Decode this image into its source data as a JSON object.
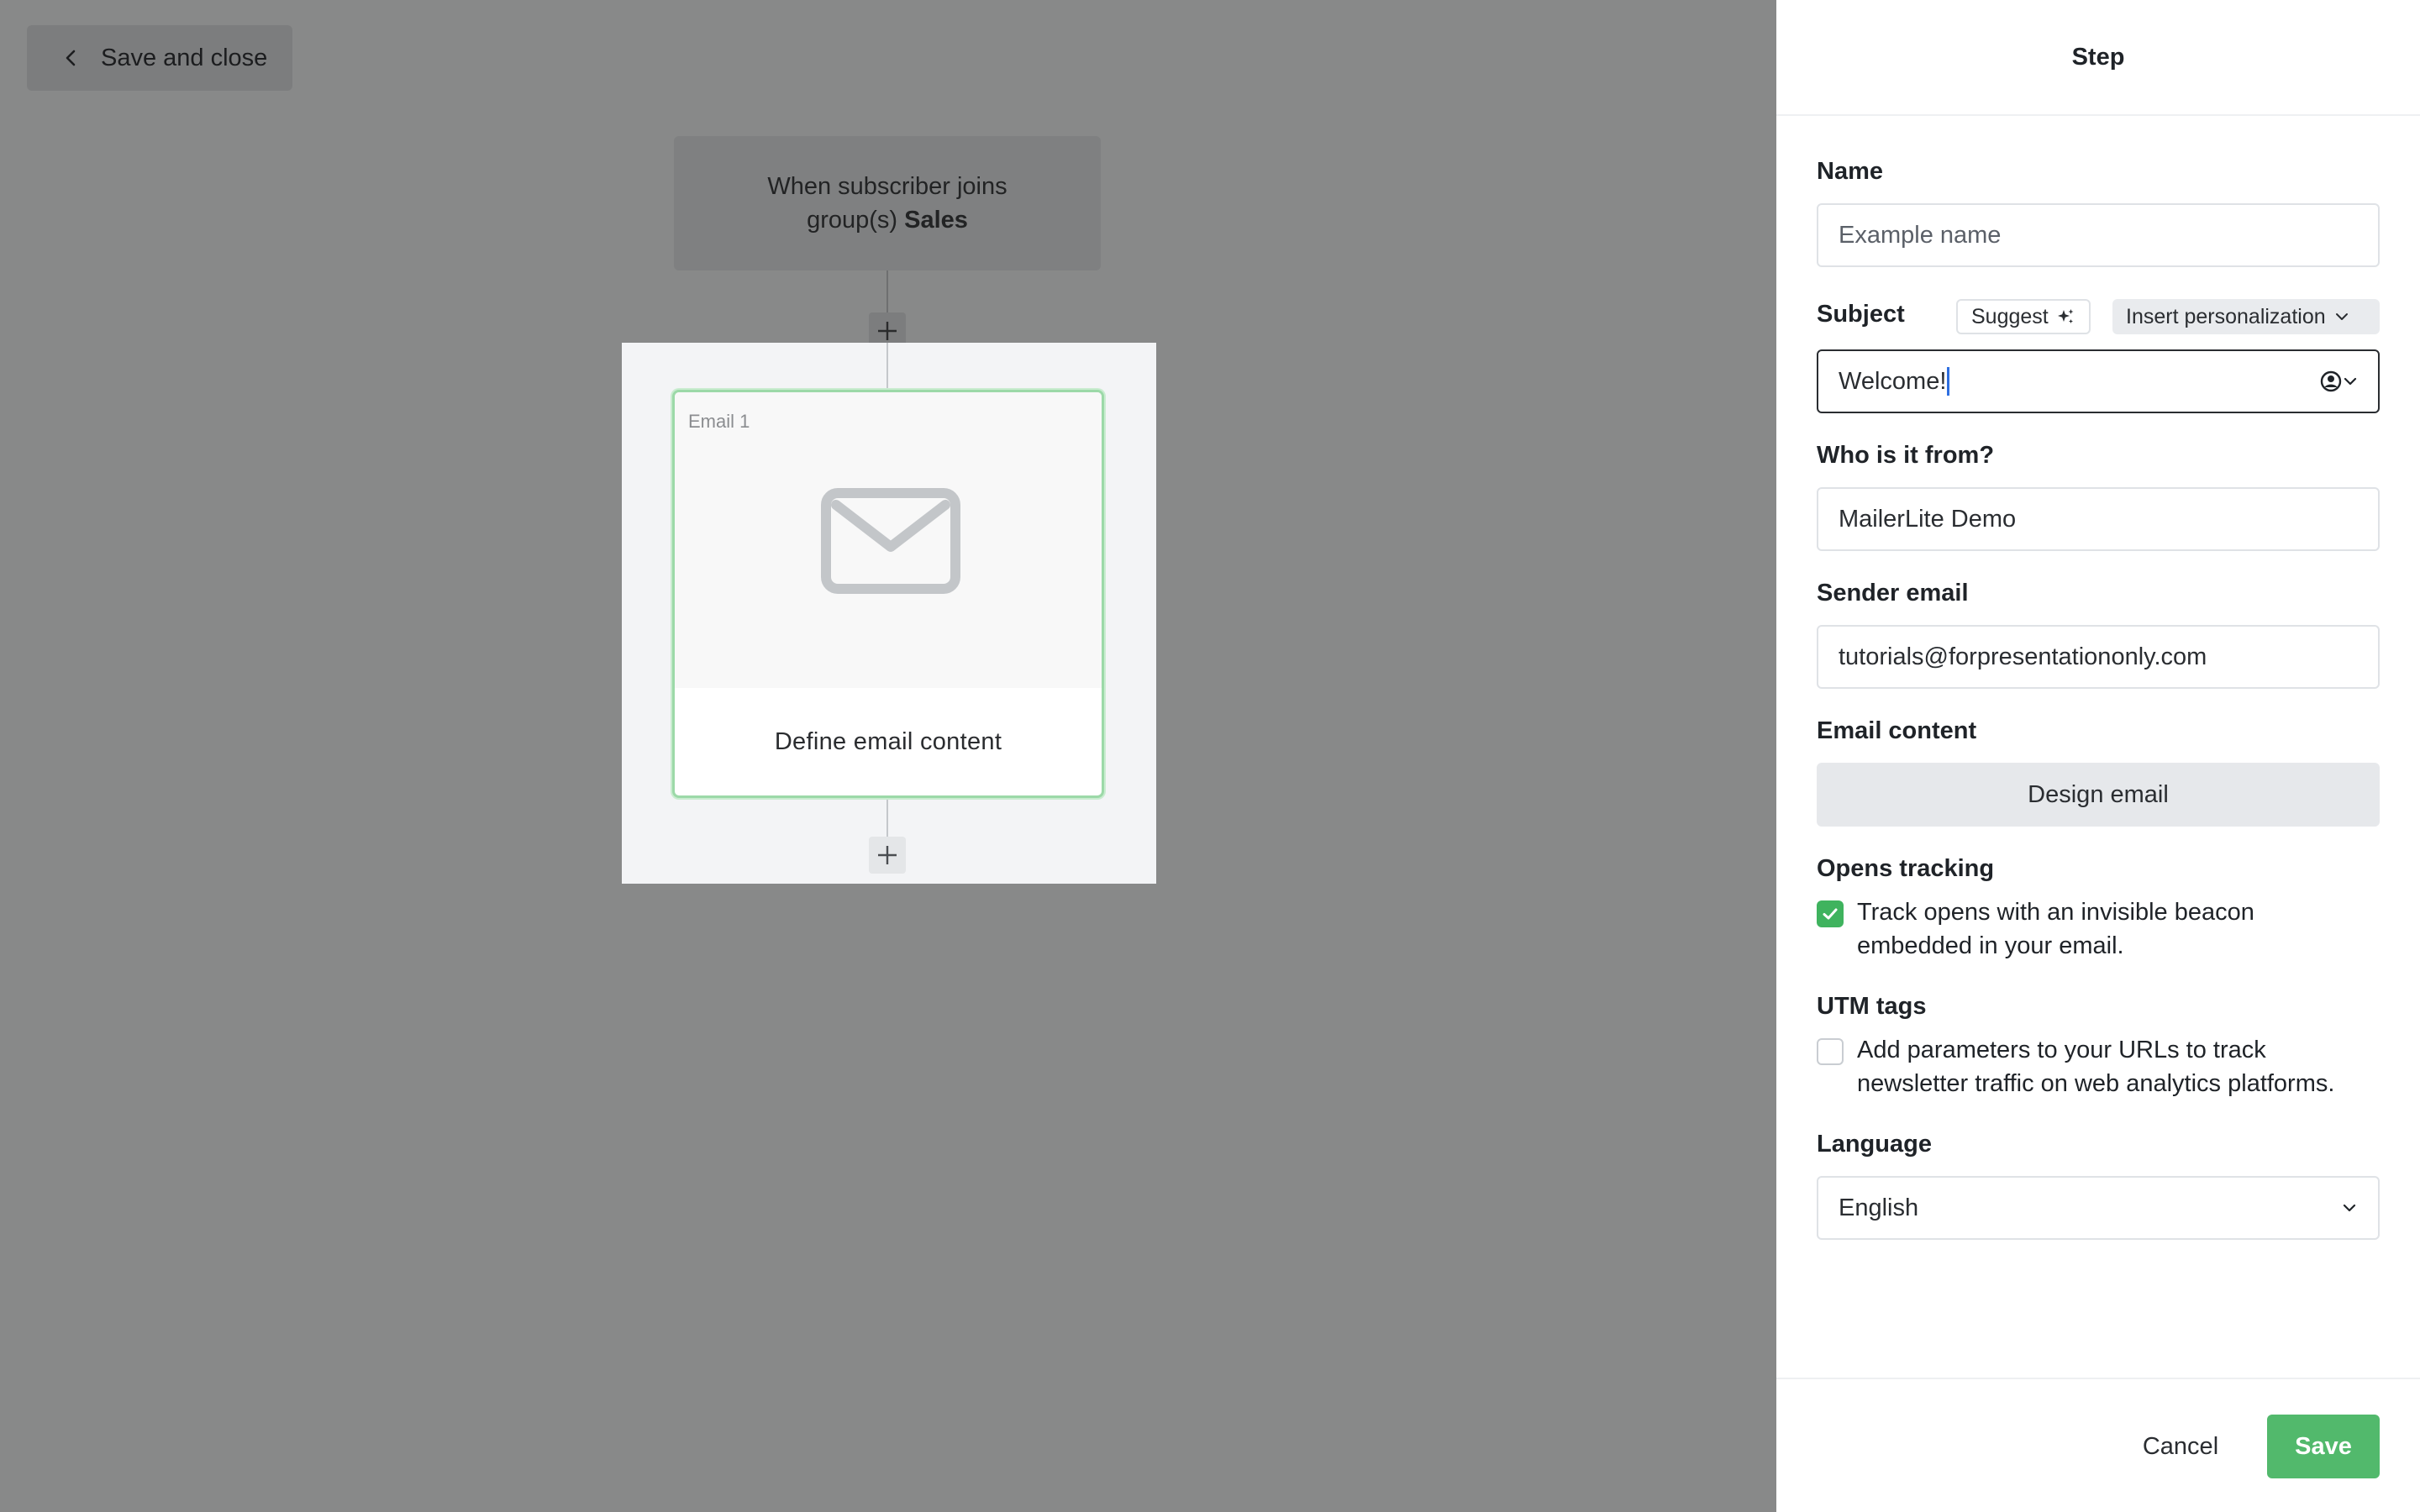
{
  "toolbar": {
    "save_close_label": "Save and close"
  },
  "workflow": {
    "trigger_text": "When subscriber joins",
    "trigger_text_2": "group(s)",
    "trigger_group": "Sales",
    "email_card": {
      "label": "Email 1",
      "content_label": "Define email content"
    }
  },
  "panel": {
    "title": "Step",
    "name": {
      "label": "Name",
      "placeholder": "Example name"
    },
    "subject": {
      "label": "Subject",
      "suggest_label": "Suggest",
      "personalization_label": "Insert personalization",
      "value": "Welcome!"
    },
    "from": {
      "label": "Who is it from?",
      "value": "MailerLite Demo"
    },
    "sender_email": {
      "label": "Sender email",
      "value": "tutorials@forpresentationonly.com"
    },
    "email_content": {
      "label": "Email content",
      "button_label": "Design email"
    },
    "opens_tracking": {
      "label": "Opens tracking",
      "checked": true,
      "line1": "Track opens with an invisible beacon",
      "line2": "embedded in your email."
    },
    "utm_tags": {
      "label": "UTM tags",
      "checked": false,
      "line1": "Add parameters to your URLs to track",
      "line2": "newsletter traffic on web analytics platforms."
    },
    "language": {
      "label": "Language",
      "selected": "English"
    },
    "footer": {
      "cancel_label": "Cancel",
      "save_label": "Save"
    }
  },
  "colors": {
    "overlay": "#888989",
    "accent_green": "#52b96c",
    "card_border": "#9cd9a8"
  }
}
